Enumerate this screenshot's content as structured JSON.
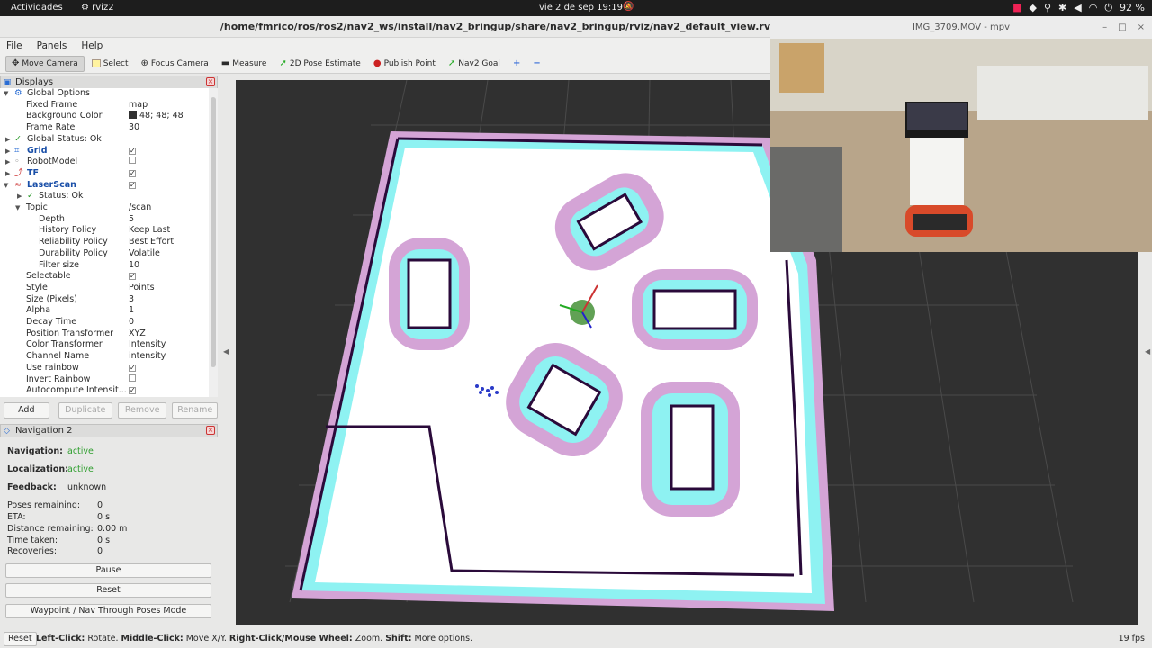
{
  "topbar": {
    "activities": "Actividades",
    "app": "rviz2",
    "clock": "vie 2 de sep  19:19",
    "battery": "92 %"
  },
  "window": {
    "title": "/home/fmrico/ros/ros2/nav2_ws/install/nav2_bringup/share/nav2_bringup/rviz/nav2_default_view.rv"
  },
  "menu": [
    "File",
    "Panels",
    "Help"
  ],
  "toolbar": {
    "move_camera": "Move Camera",
    "select": "Select",
    "focus_camera": "Focus Camera",
    "measure": "Measure",
    "pose_estimate": "2D Pose Estimate",
    "publish_point": "Publish Point",
    "nav2_goal": "Nav2 Goal"
  },
  "displays": {
    "title": "Displays",
    "global_options": "Global Options",
    "fixed_frame": {
      "label": "Fixed Frame",
      "value": "map"
    },
    "background_color": {
      "label": "Background Color",
      "value": "48; 48; 48",
      "color": "#303030"
    },
    "frame_rate": {
      "label": "Frame Rate",
      "value": "30"
    },
    "global_status": "Global Status: Ok",
    "grid": "Grid",
    "robot_model": "RobotModel",
    "tf": "TF",
    "laserscan": "LaserScan",
    "status_ok": "Status: Ok",
    "topic": {
      "label": "Topic",
      "value": "/scan"
    },
    "depth": {
      "label": "Depth",
      "value": "5"
    },
    "history_policy": {
      "label": "History Policy",
      "value": "Keep Last"
    },
    "reliability_policy": {
      "label": "Reliability Policy",
      "value": "Best Effort"
    },
    "durability_policy": {
      "label": "Durability Policy",
      "value": "Volatile"
    },
    "filter_size": {
      "label": "Filter size",
      "value": "10"
    },
    "selectable": {
      "label": "Selectable"
    },
    "style": {
      "label": "Style",
      "value": "Points"
    },
    "size_pixels": {
      "label": "Size (Pixels)",
      "value": "3"
    },
    "alpha": {
      "label": "Alpha",
      "value": "1"
    },
    "decay_time": {
      "label": "Decay Time",
      "value": "0"
    },
    "position_transformer": {
      "label": "Position Transformer",
      "value": "XYZ"
    },
    "color_transformer": {
      "label": "Color Transformer",
      "value": "Intensity"
    },
    "channel_name": {
      "label": "Channel Name",
      "value": "intensity"
    },
    "use_rainbow": {
      "label": "Use rainbow"
    },
    "invert_rainbow": {
      "label": "Invert Rainbow"
    },
    "autocompute": {
      "label": "Autocompute Intensit..."
    }
  },
  "display_buttons": {
    "add": "Add",
    "duplicate": "Duplicate",
    "remove": "Remove",
    "rename": "Rename"
  },
  "nav2": {
    "title": "Navigation 2",
    "navigation": {
      "label": "Navigation:",
      "value": "active"
    },
    "localization": {
      "label": "Localization:",
      "value": "active"
    },
    "feedback": {
      "label": "Feedback:",
      "value": "unknown"
    },
    "poses_remaining": {
      "label": "Poses remaining:",
      "value": "0"
    },
    "eta": {
      "label": "ETA:",
      "value": "0 s"
    },
    "distance_remaining": {
      "label": "Distance remaining:",
      "value": "0.00 m"
    },
    "time_taken": {
      "label": "Time taken:",
      "value": "0 s"
    },
    "recoveries": {
      "label": "Recoveries:",
      "value": "0"
    },
    "pause": "Pause",
    "reset": "Reset",
    "waypoint_mode": "Waypoint / Nav Through Poses Mode"
  },
  "video": {
    "title": "IMG_3709.MOV - mpv"
  },
  "statusbar": {
    "reset": "Reset",
    "left_click": "Left-Click:",
    "left_click_text": " Rotate. ",
    "middle_click": "Middle-Click:",
    "middle_click_text": " Move X/Y. ",
    "right_click": "Right-Click/Mouse Wheel:",
    "right_click_text": " Zoom. ",
    "shift": "Shift:",
    "shift_text": " More options.",
    "fps": "19 fps"
  }
}
